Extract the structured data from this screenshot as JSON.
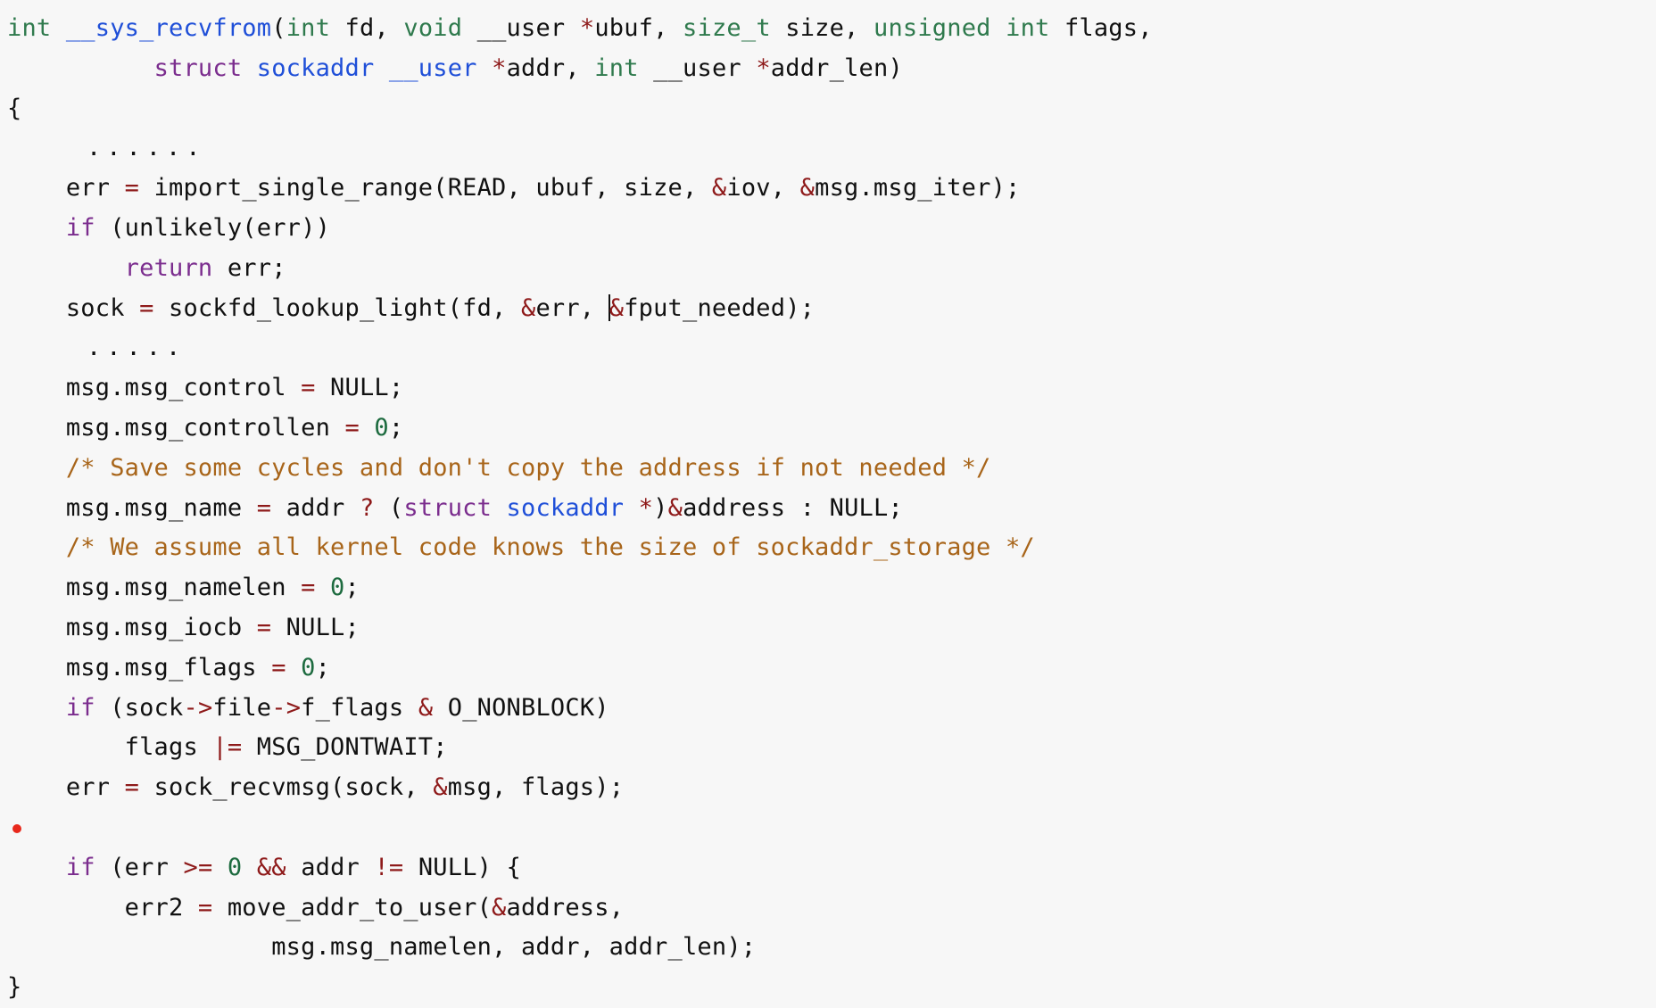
{
  "editor": {
    "background_color": "#f7f7f7",
    "foreground_color": "#111111",
    "language": "c",
    "marker": {
      "name": "breakpoint-dot",
      "color": "#e8291c",
      "line_index": 19
    },
    "caret": {
      "line_index": 6,
      "after_text": "sock = sockfd_lookup_light(fd, &err, &"
    },
    "colors": {
      "keyword": "#7b2d8e",
      "type": "#2f7a4d",
      "function": "#1f4fd8",
      "operator": "#8e1a1a",
      "number": "#1d6b3f",
      "comment": "#a8651a",
      "plain": "#111111"
    }
  },
  "lines": [
    {
      "id": "line-1",
      "indent": 0,
      "tokens": [
        {
          "t": "int",
          "c": "type"
        },
        {
          "t": " ",
          "c": "plain"
        },
        {
          "t": "__sys_recvfrom",
          "c": "fn"
        },
        {
          "t": "(",
          "c": "plain"
        },
        {
          "t": "int",
          "c": "type"
        },
        {
          "t": " fd, ",
          "c": "plain"
        },
        {
          "t": "void",
          "c": "type"
        },
        {
          "t": " __user ",
          "c": "plain"
        },
        {
          "t": "*",
          "c": "op"
        },
        {
          "t": "ubuf, ",
          "c": "plain"
        },
        {
          "t": "size_t",
          "c": "type"
        },
        {
          "t": " size, ",
          "c": "plain"
        },
        {
          "t": "unsigned",
          "c": "type"
        },
        {
          "t": " ",
          "c": "plain"
        },
        {
          "t": "int",
          "c": "type"
        },
        {
          "t": " flags,",
          "c": "plain"
        }
      ]
    },
    {
      "id": "line-2",
      "indent": 0,
      "tokens": [
        {
          "t": "          ",
          "c": "plain"
        },
        {
          "t": "struct",
          "c": "kw"
        },
        {
          "t": " ",
          "c": "plain"
        },
        {
          "t": "sockaddr",
          "c": "ident-b"
        },
        {
          "t": " ",
          "c": "plain"
        },
        {
          "t": "__user",
          "c": "ident-b"
        },
        {
          "t": " ",
          "c": "plain"
        },
        {
          "t": "*",
          "c": "op"
        },
        {
          "t": "addr, ",
          "c": "plain"
        },
        {
          "t": "int",
          "c": "type"
        },
        {
          "t": " __user ",
          "c": "plain"
        },
        {
          "t": "*",
          "c": "op"
        },
        {
          "t": "addr_len)",
          "c": "plain"
        }
      ]
    },
    {
      "id": "line-3",
      "indent": 0,
      "tokens": [
        {
          "t": "{",
          "c": "plain"
        }
      ]
    },
    {
      "id": "line-4",
      "indent": 0,
      "ellipsis": true,
      "tokens": [
        {
          "t": "    ......",
          "c": "plain"
        }
      ]
    },
    {
      "id": "line-5",
      "indent": 0,
      "tokens": [
        {
          "t": "    err ",
          "c": "plain"
        },
        {
          "t": "=",
          "c": "op"
        },
        {
          "t": " import_single_range(READ, ubuf, size, ",
          "c": "plain"
        },
        {
          "t": "&",
          "c": "op"
        },
        {
          "t": "iov, ",
          "c": "plain"
        },
        {
          "t": "&",
          "c": "op"
        },
        {
          "t": "msg.msg_iter);",
          "c": "plain"
        }
      ]
    },
    {
      "id": "line-6",
      "indent": 0,
      "tokens": [
        {
          "t": "    ",
          "c": "plain"
        },
        {
          "t": "if",
          "c": "kw"
        },
        {
          "t": " (unlikely(err))",
          "c": "plain"
        }
      ]
    },
    {
      "id": "line-7",
      "indent": 0,
      "tokens": [
        {
          "t": "        ",
          "c": "plain"
        },
        {
          "t": "return",
          "c": "kw"
        },
        {
          "t": " err;",
          "c": "plain"
        }
      ]
    },
    {
      "id": "line-8",
      "indent": 0,
      "caret_after_token": 4,
      "tokens": [
        {
          "t": "    sock ",
          "c": "plain"
        },
        {
          "t": "=",
          "c": "op"
        },
        {
          "t": " sockfd_lookup_light(fd, ",
          "c": "plain"
        },
        {
          "t": "&",
          "c": "op"
        },
        {
          "t": "err, ",
          "c": "plain"
        },
        {
          "t": "&",
          "c": "op"
        },
        {
          "t": "fput_needed);",
          "c": "plain"
        }
      ]
    },
    {
      "id": "line-9",
      "indent": 0,
      "ellipsis": true,
      "tokens": [
        {
          "t": "    .....",
          "c": "plain"
        }
      ]
    },
    {
      "id": "line-10",
      "indent": 0,
      "tokens": [
        {
          "t": "    msg.msg_control ",
          "c": "plain"
        },
        {
          "t": "=",
          "c": "op"
        },
        {
          "t": " NULL;",
          "c": "plain"
        }
      ]
    },
    {
      "id": "line-11",
      "indent": 0,
      "tokens": [
        {
          "t": "    msg.msg_controllen ",
          "c": "plain"
        },
        {
          "t": "=",
          "c": "op"
        },
        {
          "t": " ",
          "c": "plain"
        },
        {
          "t": "0",
          "c": "num"
        },
        {
          "t": ";",
          "c": "plain"
        }
      ]
    },
    {
      "id": "line-12",
      "indent": 0,
      "tokens": [
        {
          "t": "    ",
          "c": "plain"
        },
        {
          "t": "/* Save some cycles and don't copy the address if not needed */",
          "c": "comment"
        }
      ]
    },
    {
      "id": "line-13",
      "indent": 0,
      "tokens": [
        {
          "t": "    msg.msg_name ",
          "c": "plain"
        },
        {
          "t": "=",
          "c": "op"
        },
        {
          "t": " addr ",
          "c": "plain"
        },
        {
          "t": "?",
          "c": "op"
        },
        {
          "t": " (",
          "c": "plain"
        },
        {
          "t": "struct",
          "c": "kw"
        },
        {
          "t": " ",
          "c": "plain"
        },
        {
          "t": "sockaddr",
          "c": "ident-b"
        },
        {
          "t": " ",
          "c": "plain"
        },
        {
          "t": "*",
          "c": "op"
        },
        {
          "t": ")",
          "c": "plain"
        },
        {
          "t": "&",
          "c": "op"
        },
        {
          "t": "address : NULL;",
          "c": "plain"
        }
      ]
    },
    {
      "id": "line-14",
      "indent": 0,
      "tokens": [
        {
          "t": "    ",
          "c": "plain"
        },
        {
          "t": "/* We assume all kernel code knows the size of sockaddr_storage */",
          "c": "comment"
        }
      ]
    },
    {
      "id": "line-15",
      "indent": 0,
      "tokens": [
        {
          "t": "    msg.msg_namelen ",
          "c": "plain"
        },
        {
          "t": "=",
          "c": "op"
        },
        {
          "t": " ",
          "c": "plain"
        },
        {
          "t": "0",
          "c": "num"
        },
        {
          "t": ";",
          "c": "plain"
        }
      ]
    },
    {
      "id": "line-16",
      "indent": 0,
      "tokens": [
        {
          "t": "    msg.msg_iocb ",
          "c": "plain"
        },
        {
          "t": "=",
          "c": "op"
        },
        {
          "t": " NULL;",
          "c": "plain"
        }
      ]
    },
    {
      "id": "line-17",
      "indent": 0,
      "tokens": [
        {
          "t": "    msg.msg_flags ",
          "c": "plain"
        },
        {
          "t": "=",
          "c": "op"
        },
        {
          "t": " ",
          "c": "plain"
        },
        {
          "t": "0",
          "c": "num"
        },
        {
          "t": ";",
          "c": "plain"
        }
      ]
    },
    {
      "id": "line-18",
      "indent": 0,
      "tokens": [
        {
          "t": "    ",
          "c": "plain"
        },
        {
          "t": "if",
          "c": "kw"
        },
        {
          "t": " (sock",
          "c": "plain"
        },
        {
          "t": "->",
          "c": "op"
        },
        {
          "t": "file",
          "c": "plain"
        },
        {
          "t": "->",
          "c": "op"
        },
        {
          "t": "f_flags ",
          "c": "plain"
        },
        {
          "t": "&",
          "c": "op"
        },
        {
          "t": " O_NONBLOCK)",
          "c": "plain"
        }
      ]
    },
    {
      "id": "line-19",
      "indent": 0,
      "tokens": [
        {
          "t": "        flags ",
          "c": "plain"
        },
        {
          "t": "|=",
          "c": "op"
        },
        {
          "t": " MSG_DONTWAIT;",
          "c": "plain"
        }
      ]
    },
    {
      "id": "line-20",
      "indent": 0,
      "tokens": [
        {
          "t": "    err ",
          "c": "plain"
        },
        {
          "t": "=",
          "c": "op"
        },
        {
          "t": " sock_recvmsg(sock, ",
          "c": "plain"
        },
        {
          "t": "&",
          "c": "op"
        },
        {
          "t": "msg, flags);",
          "c": "plain"
        }
      ]
    },
    {
      "id": "line-21",
      "indent": 0,
      "marker": true,
      "tokens": [
        {
          "t": "",
          "c": "plain"
        }
      ]
    },
    {
      "id": "line-22",
      "indent": 0,
      "tokens": [
        {
          "t": "    ",
          "c": "plain"
        },
        {
          "t": "if",
          "c": "kw"
        },
        {
          "t": " (err ",
          "c": "plain"
        },
        {
          "t": ">=",
          "c": "op"
        },
        {
          "t": " ",
          "c": "plain"
        },
        {
          "t": "0",
          "c": "num"
        },
        {
          "t": " ",
          "c": "plain"
        },
        {
          "t": "&&",
          "c": "op"
        },
        {
          "t": " addr ",
          "c": "plain"
        },
        {
          "t": "!=",
          "c": "op"
        },
        {
          "t": " NULL) {",
          "c": "plain"
        }
      ]
    },
    {
      "id": "line-23",
      "indent": 0,
      "tokens": [
        {
          "t": "        err2 ",
          "c": "plain"
        },
        {
          "t": "=",
          "c": "op"
        },
        {
          "t": " move_addr_to_user(",
          "c": "plain"
        },
        {
          "t": "&",
          "c": "op"
        },
        {
          "t": "address,",
          "c": "plain"
        }
      ]
    },
    {
      "id": "line-24",
      "indent": 0,
      "tokens": [
        {
          "t": "                  msg.msg_namelen, addr, addr_len);",
          "c": "plain"
        }
      ]
    },
    {
      "id": "line-25",
      "indent": 0,
      "tokens": [
        {
          "t": "}",
          "c": "plain"
        }
      ]
    }
  ]
}
